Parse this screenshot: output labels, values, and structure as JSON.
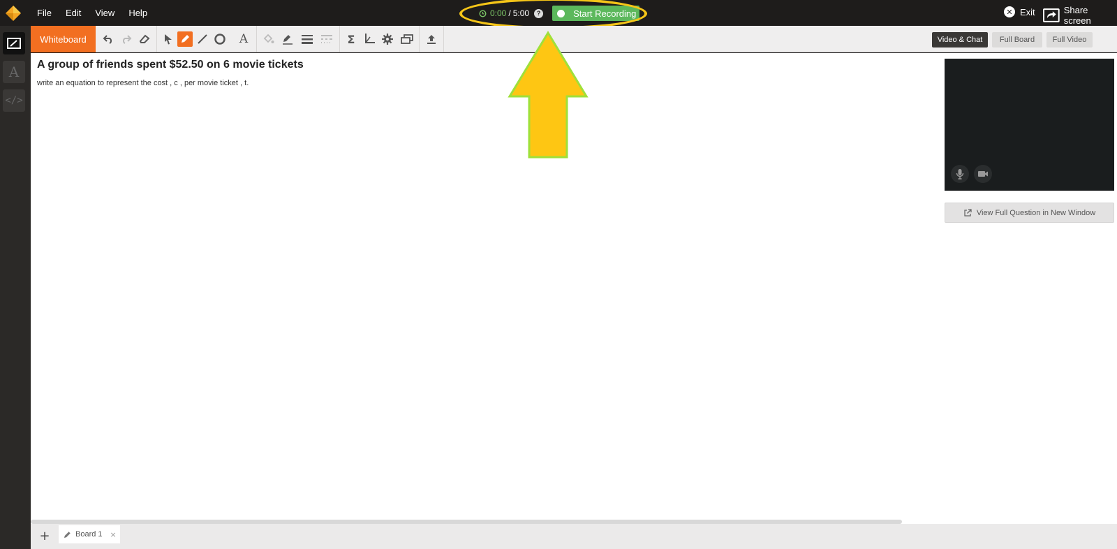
{
  "menu": {
    "file": "File",
    "edit": "Edit",
    "view": "View",
    "help": "Help"
  },
  "recording": {
    "elapsed": "0:00",
    "separator": "/",
    "limit": "5:00",
    "help": "?",
    "start_label": "Start Recording"
  },
  "topright": {
    "exit_label": "Exit",
    "share_label": "Share screen"
  },
  "toolbar": {
    "whiteboard_tab": "Whiteboard"
  },
  "views": {
    "video_chat": "Video & Chat",
    "full_board": "Full Board",
    "full_video": "Full Video"
  },
  "question": {
    "title": "A group of friends spent $52.50 on 6 movie tickets",
    "body": "write an equation to represent the cost , c , per movie ticket , t."
  },
  "side": {
    "view_full_question": "View Full Question in New Window"
  },
  "boards": {
    "add": "+",
    "tabs": [
      {
        "label": "Board 1",
        "close": "×"
      }
    ]
  },
  "colors": {
    "accent": "#f26f21",
    "record_green": "#5cb85c",
    "annotation_yellow": "#f5c518",
    "annotation_outline": "#9fe03a"
  }
}
